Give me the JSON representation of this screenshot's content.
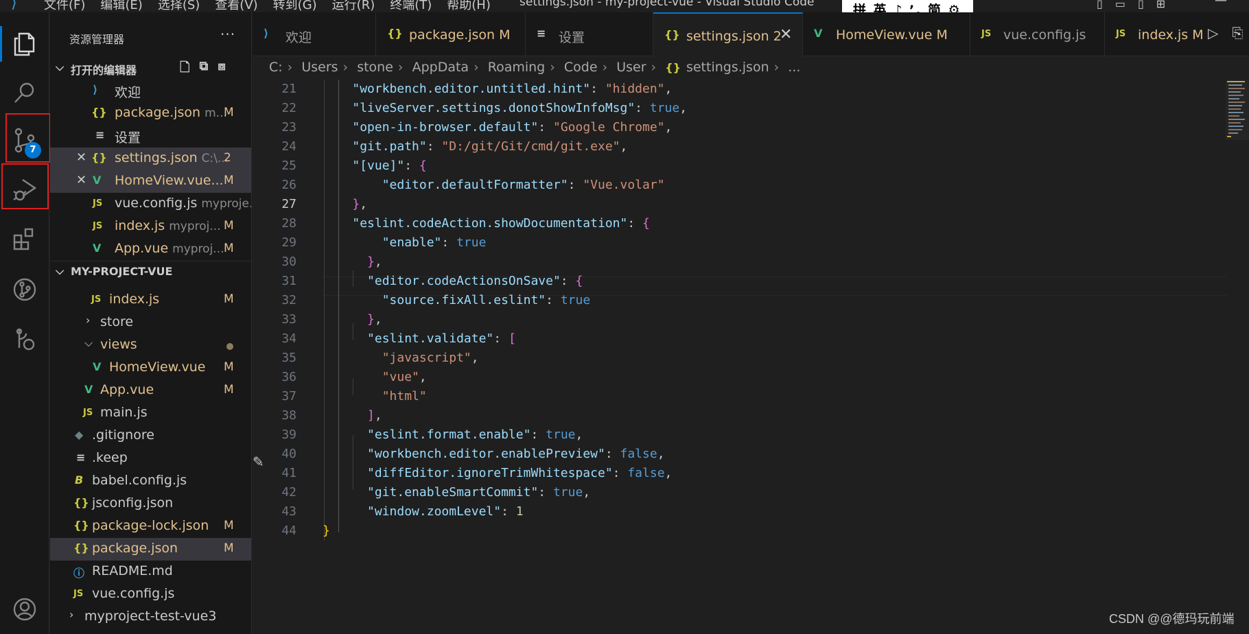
{
  "titlebar": {
    "menus": [
      "文件(F)",
      "编辑(E)",
      "选择(S)",
      "查看(V)",
      "转到(G)",
      "运行(R)",
      "终端(T)",
      "帮助(H)"
    ],
    "window_title": "settings.json - my-project-vue - Visual Studio Code",
    "ime_status": "拼 英 ♪ ’, 简 ⚙ ⁚"
  },
  "activitybar": {
    "items": [
      "explorer",
      "search",
      "source-control",
      "run-and-debug",
      "extensions",
      "git-graph",
      "remote-explorer",
      "accounts"
    ],
    "scm_badge": "7"
  },
  "sidebar": {
    "title": "资源管理器",
    "more": "···",
    "open_editors": {
      "label": "打开的编辑器",
      "items": [
        {
          "name": "欢迎",
          "hint": "",
          "status": ""
        },
        {
          "name": "package.json",
          "hint": "m...",
          "status": "M"
        },
        {
          "name": "设置",
          "hint": "",
          "status": ""
        },
        {
          "name": "settings.json",
          "hint": "C:\\...",
          "status": "2"
        },
        {
          "name": "HomeView.vue...",
          "hint": "",
          "status": "M"
        },
        {
          "name": "vue.config.js",
          "hint": "myproje...",
          "status": ""
        },
        {
          "name": "index.js",
          "hint": "myproj...",
          "status": "M"
        },
        {
          "name": "App.vue",
          "hint": "myproj...",
          "status": "M"
        }
      ]
    },
    "project": {
      "label": "MY-PROJECT-VUE",
      "items": [
        {
          "name": "index.js",
          "status": "M"
        },
        {
          "name": "store",
          "status": ""
        },
        {
          "name": "views",
          "status": ""
        },
        {
          "name": "HomeView.vue",
          "status": "M"
        },
        {
          "name": "App.vue",
          "status": "M"
        },
        {
          "name": "main.js",
          "status": ""
        },
        {
          "name": ".gitignore",
          "status": ""
        },
        {
          "name": ".keep",
          "status": ""
        },
        {
          "name": "babel.config.js",
          "status": ""
        },
        {
          "name": "jsconfig.json",
          "status": ""
        },
        {
          "name": "package-lock.json",
          "status": "M"
        },
        {
          "name": "package.json",
          "status": "M"
        },
        {
          "name": "README.md",
          "status": ""
        },
        {
          "name": "vue.config.js",
          "status": ""
        },
        {
          "name": "myproject-test-vue3",
          "status": ""
        }
      ]
    }
  },
  "tabs": [
    {
      "name": "欢迎",
      "status": ""
    },
    {
      "name": "package.json",
      "status": "M"
    },
    {
      "name": "设置",
      "status": ""
    },
    {
      "name": "settings.json",
      "status": "2"
    },
    {
      "name": "HomeView.vue",
      "status": "M"
    },
    {
      "name": "vue.config.js",
      "status": ""
    },
    {
      "name": "index.js",
      "status": "M"
    }
  ],
  "breadcrumb": [
    "C:",
    "Users",
    "stone",
    "AppData",
    "Roaming",
    "Code",
    "User",
    "settings.json",
    "..."
  ],
  "editor": {
    "current_line": 27,
    "line_numbers": [
      "21",
      "22",
      "23",
      "24",
      "25",
      "26",
      "27",
      "28",
      "29",
      "30",
      "31",
      "32",
      "33",
      "34",
      "35",
      "36",
      "37",
      "38",
      "39",
      "40",
      "41",
      "42",
      "43",
      "44"
    ],
    "code": {
      "l21": {
        "key": "\"workbench.editor.untitled.hint\"",
        "val": "\"hidden\""
      },
      "l22": {
        "key": "\"liveServer.settings.donotShowInfoMsg\"",
        "val": "true"
      },
      "l23": {
        "key": "\"open-in-browser.default\"",
        "val": "\"Google Chrome\""
      },
      "l24": {
        "key": "\"git.path\"",
        "val": "\"D:/git/Git/cmd/git.exe\""
      },
      "l25": {
        "key": "\"[vue]\""
      },
      "l26": {
        "key": "\"editor.defaultFormatter\"",
        "val": "\"Vue.volar\""
      },
      "l28": {
        "key": "\"eslint.codeAction.showDocumentation\""
      },
      "l29": {
        "key": "\"enable\"",
        "val": "true"
      },
      "l31": {
        "key": "\"editor.codeActionsOnSave\""
      },
      "l32": {
        "key": "\"source.fixAll.eslint\"",
        "val": "true"
      },
      "l34": {
        "key": "\"eslint.validate\""
      },
      "l35": {
        "val": "\"javascript\""
      },
      "l36": {
        "val": "\"vue\""
      },
      "l37": {
        "val": "\"html\""
      },
      "l39": {
        "key": "\"eslint.format.enable\"",
        "val": "true"
      },
      "l40": {
        "key": "\"workbench.editor.enablePreview\"",
        "val": "false"
      },
      "l41": {
        "key": "\"diffEditor.ignoreTrimWhitespace\"",
        "val": "false"
      },
      "l42": {
        "key": "\"git.enableSmartCommit\"",
        "val": "true"
      },
      "l43": {
        "key": "\"window.zoomLevel\"",
        "val": "1"
      }
    }
  },
  "watermark": "CSDN @@德玛玩前端",
  "colors": {
    "accent": "#0078d4",
    "badge": "#0078d4",
    "highlight_box": "#e01e1e",
    "modified": "#e2c08d",
    "vue": "#41b883",
    "json": "#cbcb41"
  }
}
